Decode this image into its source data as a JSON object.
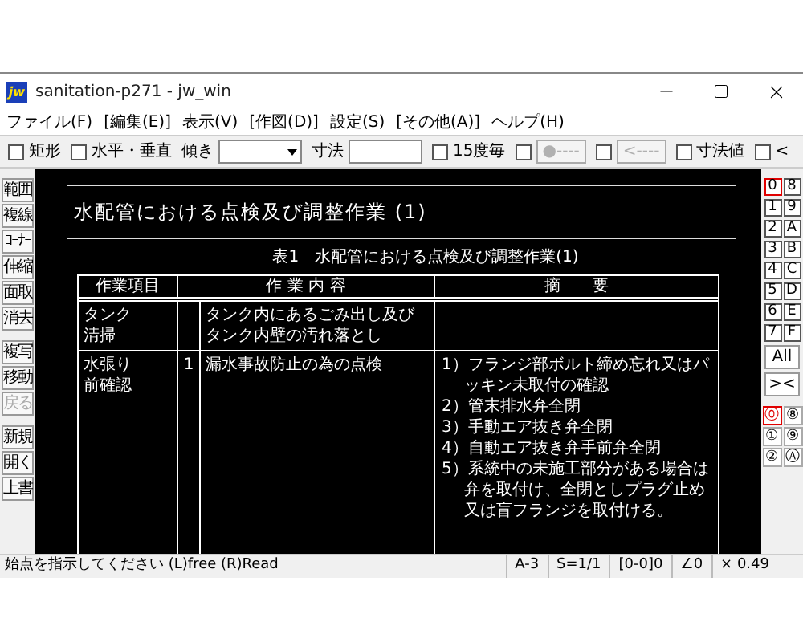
{
  "window": {
    "icon_text": "jw",
    "title": "sanitation-p271 - jw_win"
  },
  "menu": [
    "ファイル(F)",
    "[編集(E)]",
    "表示(V)",
    "[作図(D)]",
    "設定(S)",
    "[その他(A)]",
    "ヘルプ(H)"
  ],
  "toolbar": [
    {
      "kind": "checkbox",
      "label": "矩形",
      "checked": false
    },
    {
      "kind": "checkbox",
      "label": "水平・垂直",
      "checked": false
    },
    {
      "kind": "select",
      "label": "傾き"
    },
    {
      "kind": "input",
      "label": "寸法"
    },
    {
      "kind": "checkbox",
      "label": "15度毎",
      "checked": false
    },
    {
      "kind": "checkbutton",
      "button": "●----",
      "checked": false,
      "disabled": true
    },
    {
      "kind": "checkbutton",
      "button": "<----",
      "checked": false,
      "disabled": true
    },
    {
      "kind": "checkbox",
      "label": "寸法値",
      "checked": false
    },
    {
      "kind": "checkbox",
      "label": "<",
      "checked": false
    }
  ],
  "left_tools": [
    {
      "label": "範囲",
      "disabled": false,
      "gap": false
    },
    {
      "label": "複線",
      "disabled": false,
      "gap": false
    },
    {
      "label": "ｺｰﾅｰ",
      "disabled": false,
      "gap": false
    },
    {
      "label": "伸縮",
      "disabled": false,
      "gap": false
    },
    {
      "label": "面取",
      "disabled": false,
      "gap": false
    },
    {
      "label": "消去",
      "disabled": false,
      "gap": false
    },
    {
      "label": "複写",
      "disabled": false,
      "gap": true
    },
    {
      "label": "移動",
      "disabled": false,
      "gap": false
    },
    {
      "label": "戻る",
      "disabled": true,
      "gap": false
    },
    {
      "label": "新規",
      "disabled": false,
      "gap": true
    },
    {
      "label": "開く",
      "disabled": false,
      "gap": false
    },
    {
      "label": "上書",
      "disabled": false,
      "gap": false
    }
  ],
  "drawing": {
    "title": "水配管における点検及び調整作業 (1)",
    "caption": "表1　水配管における点検及び調整作業(1)",
    "table": {
      "columns": [
        "作業項目",
        "作 業 内 容",
        "摘　　要"
      ],
      "rows": [
        {
          "item": "タンク清掃",
          "no": "",
          "content": [
            "タンク内にあるごみ出し及び",
            "タンク内壁の汚れ落とし"
          ],
          "notes": []
        },
        {
          "item": "水張り前確認",
          "no": "1",
          "content": [
            "漏水事故防止の為の点検"
          ],
          "notes": [
            "1）フランジ部ボルト締め忘れ又はパッキン未取付の確認",
            "2）管末排水弁全閉",
            "3）手動エア抜き弁全閉",
            "4）自動エア抜き弁手前弁全閉",
            "5）系統中の未施工部分がある場合は弁を取付け、全閉としプラグ止め又は盲フランジを取付ける。"
          ]
        }
      ]
    }
  },
  "layers": [
    {
      "label": "0",
      "selected": true
    },
    {
      "label": "8",
      "selected": false
    },
    {
      "label": "1",
      "selected": false
    },
    {
      "label": "9",
      "selected": false
    },
    {
      "label": "2",
      "selected": false
    },
    {
      "label": "A",
      "selected": false
    },
    {
      "label": "3",
      "selected": false
    },
    {
      "label": "B",
      "selected": false
    },
    {
      "label": "4",
      "selected": false
    },
    {
      "label": "C",
      "selected": false
    },
    {
      "label": "5",
      "selected": false
    },
    {
      "label": "D",
      "selected": false
    },
    {
      "label": "6",
      "selected": false
    },
    {
      "label": "E",
      "selected": false
    },
    {
      "label": "7",
      "selected": false
    },
    {
      "label": "F",
      "selected": false
    }
  ],
  "layer_buttons": [
    "All",
    "><"
  ],
  "layer_groups": [
    {
      "label": "⓪",
      "selected": true
    },
    {
      "label": "⑧",
      "selected": false
    },
    {
      "label": "①",
      "selected": false
    },
    {
      "label": "⑨",
      "selected": false
    },
    {
      "label": "②",
      "selected": false
    },
    {
      "label": "Ⓐ",
      "selected": false
    }
  ],
  "status_bar": {
    "message": "始点を指示してください (L)free (R)Read",
    "cells": [
      "A-3",
      "S=1/1",
      "[0-0]0",
      "∠0",
      "× 0.49"
    ]
  }
}
